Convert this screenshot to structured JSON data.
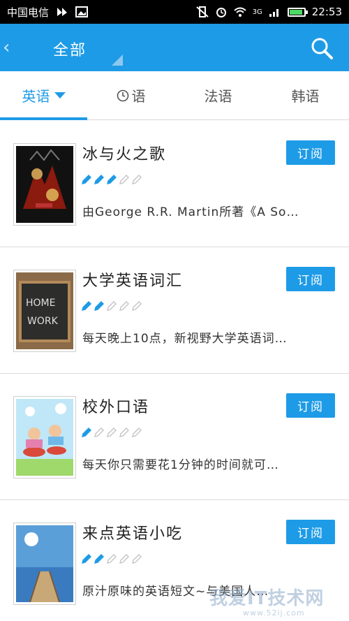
{
  "status_bar": {
    "carrier": "中国电信",
    "network": "3G",
    "time": "22:53"
  },
  "appbar": {
    "title": "全部",
    "back_icon": "chevron-left-icon",
    "search_icon": "search-icon"
  },
  "tabs": [
    {
      "label": "英语",
      "active": true
    },
    {
      "label": "语",
      "active": false,
      "icon": "clock-icon"
    },
    {
      "label": "法语",
      "active": false
    },
    {
      "label": "韩语",
      "active": false
    }
  ],
  "items": [
    {
      "title": "冰与火之歌",
      "subscribe_label": "订阅",
      "rating": 3,
      "rating_max": 5,
      "desc": "由George R.R. Martin所著《A So…"
    },
    {
      "title": "大学英语词汇",
      "subscribe_label": "订阅",
      "rating": 2,
      "rating_max": 5,
      "desc": "每天晚上10点，新视野大学英语词…"
    },
    {
      "title": "校外口语",
      "subscribe_label": "订阅",
      "rating": 1,
      "rating_max": 5,
      "desc": "每天你只需要花1分钟的时间就可…"
    },
    {
      "title": "来点英语小吃",
      "subscribe_label": "订阅",
      "rating": 2,
      "rating_max": 5,
      "desc": "原汁原味的英语短文~与美国人…"
    }
  ],
  "colors": {
    "accent": "#1e9be6",
    "rating_on": "#1e9be6",
    "rating_off": "#c4c4c4"
  },
  "watermark": {
    "text": "我爱IT技术网",
    "sub": "www.52ij.com"
  }
}
